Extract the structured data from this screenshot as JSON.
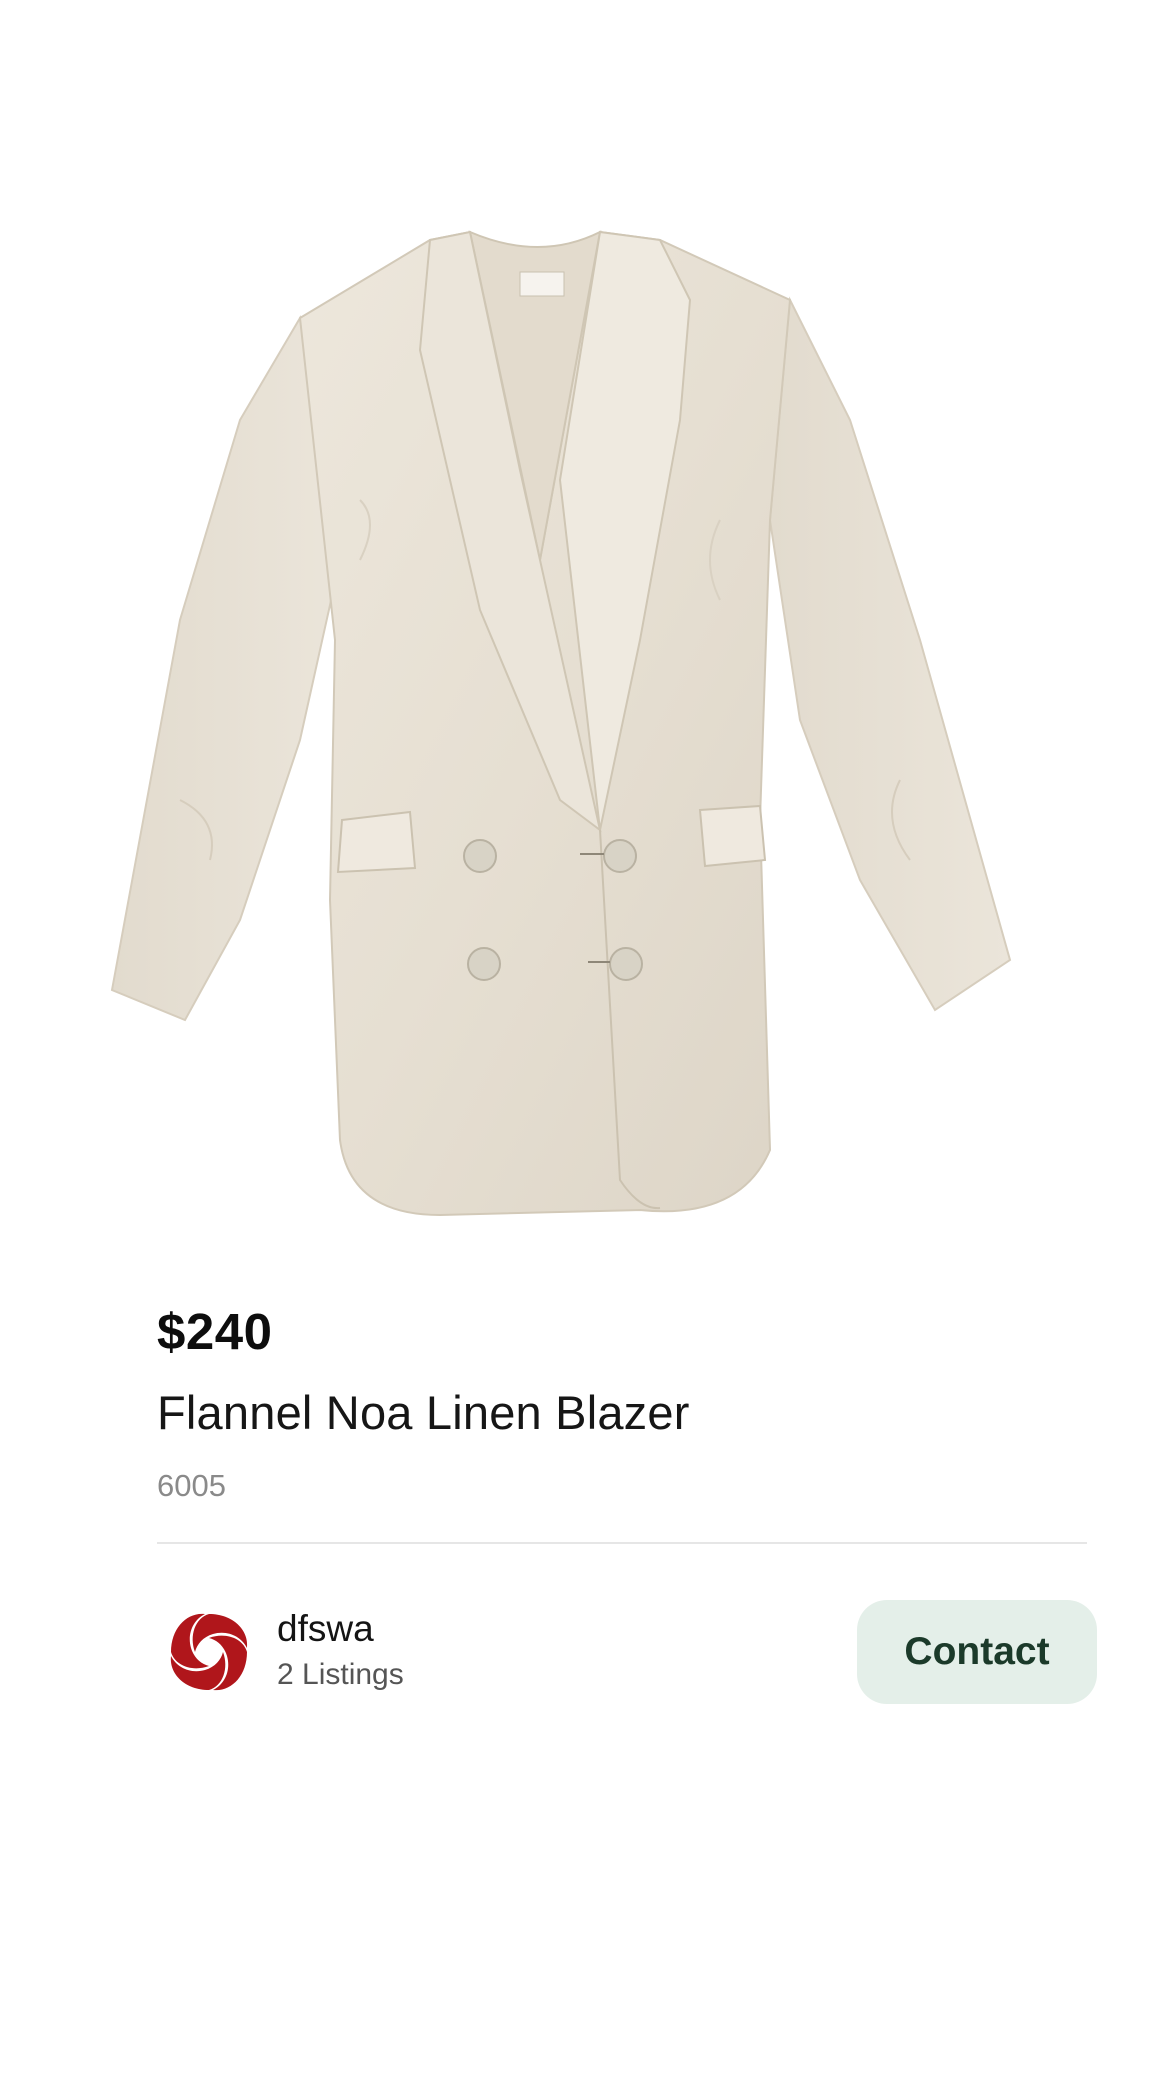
{
  "product": {
    "image_alt": "Linen blazer",
    "price": "$240",
    "title": "Flannel Noa Linen Blazer",
    "code": "6005"
  },
  "seller": {
    "name": "dfswa",
    "listings": "2 Listings",
    "avatar_icon": "red-swirl-logo-icon"
  },
  "actions": {
    "contact_label": "Contact"
  },
  "colors": {
    "contact_bg": "#e4efe9",
    "contact_text": "#1b3a2a",
    "avatar_red": "#b0161b",
    "blazer": "#e9e2d6"
  }
}
